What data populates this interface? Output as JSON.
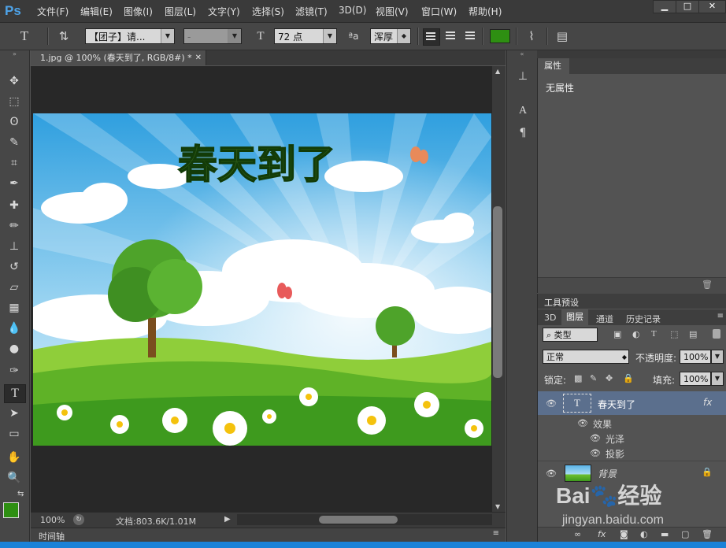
{
  "app": {
    "logo": "Ps"
  },
  "menu": [
    "文件(F)",
    "编辑(E)",
    "图像(I)",
    "图层(L)",
    "文字(Y)",
    "选择(S)",
    "滤镜(T)",
    "3D(D)",
    "视图(V)",
    "窗口(W)",
    "帮助(H)"
  ],
  "options": {
    "font_family": "【团子】请...",
    "font_style": "-",
    "font_size": "72 点",
    "aa_label": "ªa",
    "antialias": "浑厚",
    "text_color": "#2e8f12"
  },
  "document": {
    "tab_title": "1.jpg @ 100% (春天到了, RGB/8#) *",
    "canvas_text": "春天到了",
    "zoom": "100%",
    "doc_info": "文档:803.6K/1.01M",
    "timeline": "时间轴"
  },
  "properties": {
    "tab": "属性",
    "empty": "无属性"
  },
  "tool_presets": {
    "tab": "工具预设"
  },
  "layers_panel": {
    "tabs": [
      "3D",
      "图层",
      "通道",
      "历史记录"
    ],
    "filter_kind": "类型",
    "blend_mode": "正常",
    "opacity_label": "不透明度:",
    "opacity": "100%",
    "lock_label": "锁定:",
    "fill_label": "填充:",
    "fill": "100%",
    "layers": [
      {
        "name": "春天到了",
        "fx": "fx"
      },
      {
        "name": "效果"
      },
      {
        "name": "光泽"
      },
      {
        "name": "投影"
      },
      {
        "name": "背景"
      }
    ]
  },
  "watermark": {
    "main": "Bai🐾经验",
    "sub": "jingyan.baidu.com"
  }
}
